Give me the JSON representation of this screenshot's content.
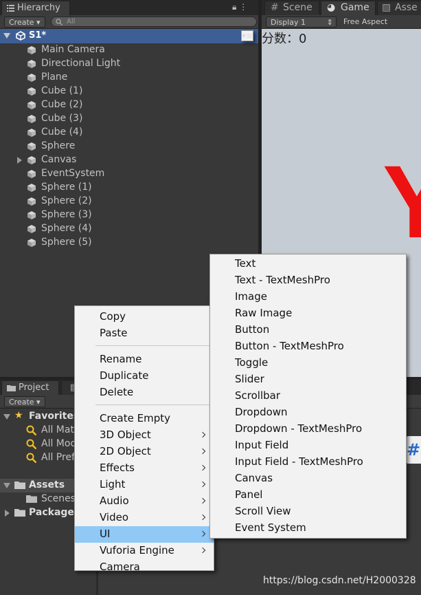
{
  "hierarchy": {
    "tab_label": "Hierarchy",
    "create_label": "Create",
    "search_placeholder": "All",
    "scene_name": "S1*",
    "items": [
      {
        "label": "Main Camera"
      },
      {
        "label": "Directional Light"
      },
      {
        "label": "Plane"
      },
      {
        "label": "Cube (1)"
      },
      {
        "label": "Cube (2)"
      },
      {
        "label": "Cube (3)"
      },
      {
        "label": "Cube (4)"
      },
      {
        "label": "Sphere"
      },
      {
        "label": "Canvas",
        "expandable": true
      },
      {
        "label": "EventSystem"
      },
      {
        "label": "Sphere (1)"
      },
      {
        "label": "Sphere (2)"
      },
      {
        "label": "Sphere (3)"
      },
      {
        "label": "Sphere (4)"
      },
      {
        "label": "Sphere (5)"
      }
    ]
  },
  "game_panel": {
    "tabs": [
      "Scene",
      "Game",
      "Asse"
    ],
    "display_label": "Display 1",
    "aspect_label": "Free Aspect",
    "score_text": "分数：0",
    "big_letter": "Y"
  },
  "project": {
    "tab_label": "Project",
    "create_label": "Create",
    "favorites_label": "Favorites",
    "favorite_items": [
      "All Mate",
      "All Mod",
      "All Pref"
    ],
    "assets_label": "Assets",
    "scenes_label": "Scenes",
    "packages_label": "Packages"
  },
  "context_menu": {
    "items": [
      {
        "label": "Copy"
      },
      {
        "label": "Paste"
      },
      {
        "separator": true
      },
      {
        "label": "Rename"
      },
      {
        "label": "Duplicate"
      },
      {
        "label": "Delete"
      },
      {
        "separator": true
      },
      {
        "label": "Create Empty"
      },
      {
        "label": "3D Object",
        "submenu": true
      },
      {
        "label": "2D Object",
        "submenu": true
      },
      {
        "label": "Effects",
        "submenu": true
      },
      {
        "label": "Light",
        "submenu": true
      },
      {
        "label": "Audio",
        "submenu": true
      },
      {
        "label": "Video",
        "submenu": true
      },
      {
        "label": "UI",
        "submenu": true,
        "highlighted": true
      },
      {
        "label": "Vuforia Engine",
        "submenu": true
      },
      {
        "label": "Camera"
      }
    ]
  },
  "ui_submenu": {
    "items": [
      "Text",
      "Text - TextMeshPro",
      "Image",
      "Raw Image",
      "Button",
      "Button - TextMeshPro",
      "Toggle",
      "Slider",
      "Scrollbar",
      "Dropdown",
      "Dropdown - TextMeshPro",
      "Input Field",
      "Input Field - TextMeshPro",
      "Canvas",
      "Panel",
      "Scroll View",
      "Event System"
    ]
  },
  "watermark": "https://blog.csdn.net/H2000328",
  "colors": {
    "selection": "#3e5f96",
    "menu_highlight": "#90c8f6",
    "red_letter": "#ee1111"
  }
}
